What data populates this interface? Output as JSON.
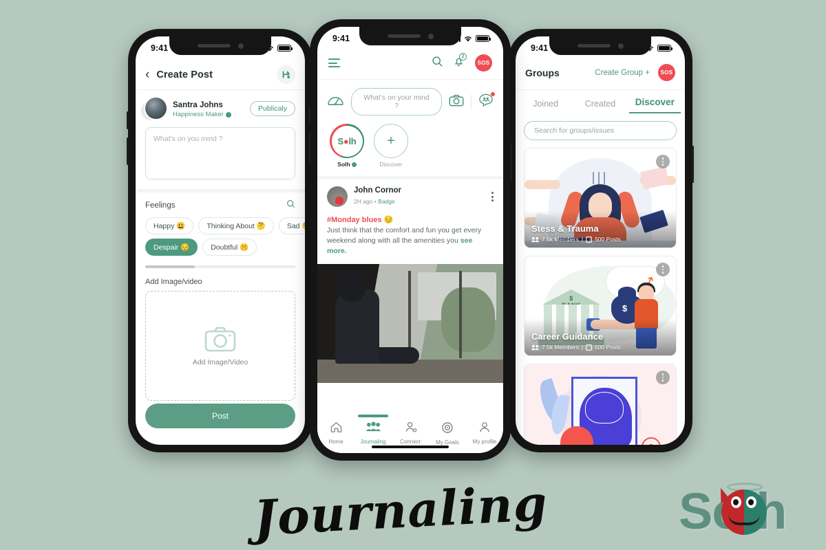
{
  "background_color": "#b5c9bf",
  "brand": {
    "headline": "Journaling",
    "logo_text": "Solh",
    "accent_green": "#4d9a7f",
    "accent_red": "#ef4c53"
  },
  "phone1": {
    "status": {
      "time": "9:41"
    },
    "header": {
      "back_icon": "chevron-left-icon",
      "title": "Create Post",
      "save_icon": "save-icon"
    },
    "user": {
      "name": "Santra Johns",
      "role": "Happiness Maker",
      "verified_icon": "verified-badge-icon",
      "swap_icon": "swap-icon",
      "audience_label": "Publicaly"
    },
    "composer": {
      "placeholder": "What's on you mind ?"
    },
    "feelings": {
      "title": "Feelings",
      "search_icon": "search-icon",
      "chips": [
        {
          "label": "Happy",
          "emoji": "😃",
          "selected": false
        },
        {
          "label": "Thinking About",
          "emoji": "🤔",
          "selected": false
        },
        {
          "label": "Sad",
          "emoji": "😟",
          "selected": false
        },
        {
          "label": "Despair",
          "emoji": "😔",
          "selected": true
        },
        {
          "label": "Doubtful",
          "emoji": "🤫",
          "selected": false
        }
      ]
    },
    "upload": {
      "section_label": "Add Image/video",
      "dropzone_icon": "camera-icon",
      "dropzone_label": "Add Image/Video"
    },
    "post_button": "Post"
  },
  "phone2": {
    "status": {
      "time": "9:41"
    },
    "header": {
      "menu_icon": "hamburger-menu-icon",
      "search_icon": "search-icon",
      "bell_icon": "bell-icon",
      "bell_badge": "2",
      "sos_label": "SOS"
    },
    "composer": {
      "mood_icon": "mood-meter-icon",
      "placeholder": "What's on your mind ?",
      "camera_icon": "camera-icon",
      "group-chat_icon": "group-chat-icon"
    },
    "stories": [
      {
        "label": "Solh",
        "type": "own",
        "verified_icon": "verified-badge-icon"
      },
      {
        "label": "Discover",
        "type": "discover",
        "icon": "plus-icon"
      }
    ],
    "post": {
      "author": "John Cornor",
      "time": "2H ago",
      "separator": "•",
      "badge": "Badge",
      "more_icon": "kebab-menu-icon",
      "hashtag": "#Monday blues",
      "hashtag_emoji": "😔",
      "text": "Just think that the comfort and fun you get every weekend along with all the amenities you",
      "see_more": "see more.",
      "photo_alt": "woman-sitting-by-window-photo"
    },
    "tabbar": [
      {
        "label": "Home",
        "icon": "home-icon",
        "active": false
      },
      {
        "label": "Journaling",
        "icon": "people-group-icon",
        "active": true
      },
      {
        "label": "Connect",
        "icon": "connect-person-icon",
        "active": false
      },
      {
        "label": "My Goals",
        "icon": "target-icon",
        "active": false
      },
      {
        "label": "My profile",
        "icon": "person-icon",
        "active": false
      }
    ]
  },
  "phone3": {
    "status": {
      "time": "9:41"
    },
    "header": {
      "title": "Groups",
      "create_label": "Create Group +",
      "sos_label": "SOS"
    },
    "tabs": [
      {
        "label": "Joined",
        "active": false
      },
      {
        "label": "Created",
        "active": false
      },
      {
        "label": "Discover",
        "active": true
      }
    ],
    "search": {
      "placeholder": "Search for groups/issues"
    },
    "cards": [
      {
        "title": "Stess & Trauma",
        "members": "7.5k Members",
        "divider": "|",
        "posts": "500 Posts",
        "members_icon": "people-icon",
        "posts_icon": "post-icon",
        "menu_icon": "kebab-menu-icon",
        "illustration": "stressed-woman-illustration"
      },
      {
        "title": "Career Guidance",
        "members": "7.5k Members",
        "divider": "|",
        "posts": "500 Posts",
        "members_icon": "people-icon",
        "posts_icon": "post-icon",
        "menu_icon": "kebab-menu-icon",
        "illustration": "bank-money-growth-illustration"
      },
      {
        "title": "",
        "members": "",
        "divider": "",
        "posts": "",
        "members_icon": "people-icon",
        "posts_icon": "post-icon",
        "menu_icon": "kebab-menu-icon",
        "illustration": "brain-mind-illustration"
      }
    ]
  }
}
